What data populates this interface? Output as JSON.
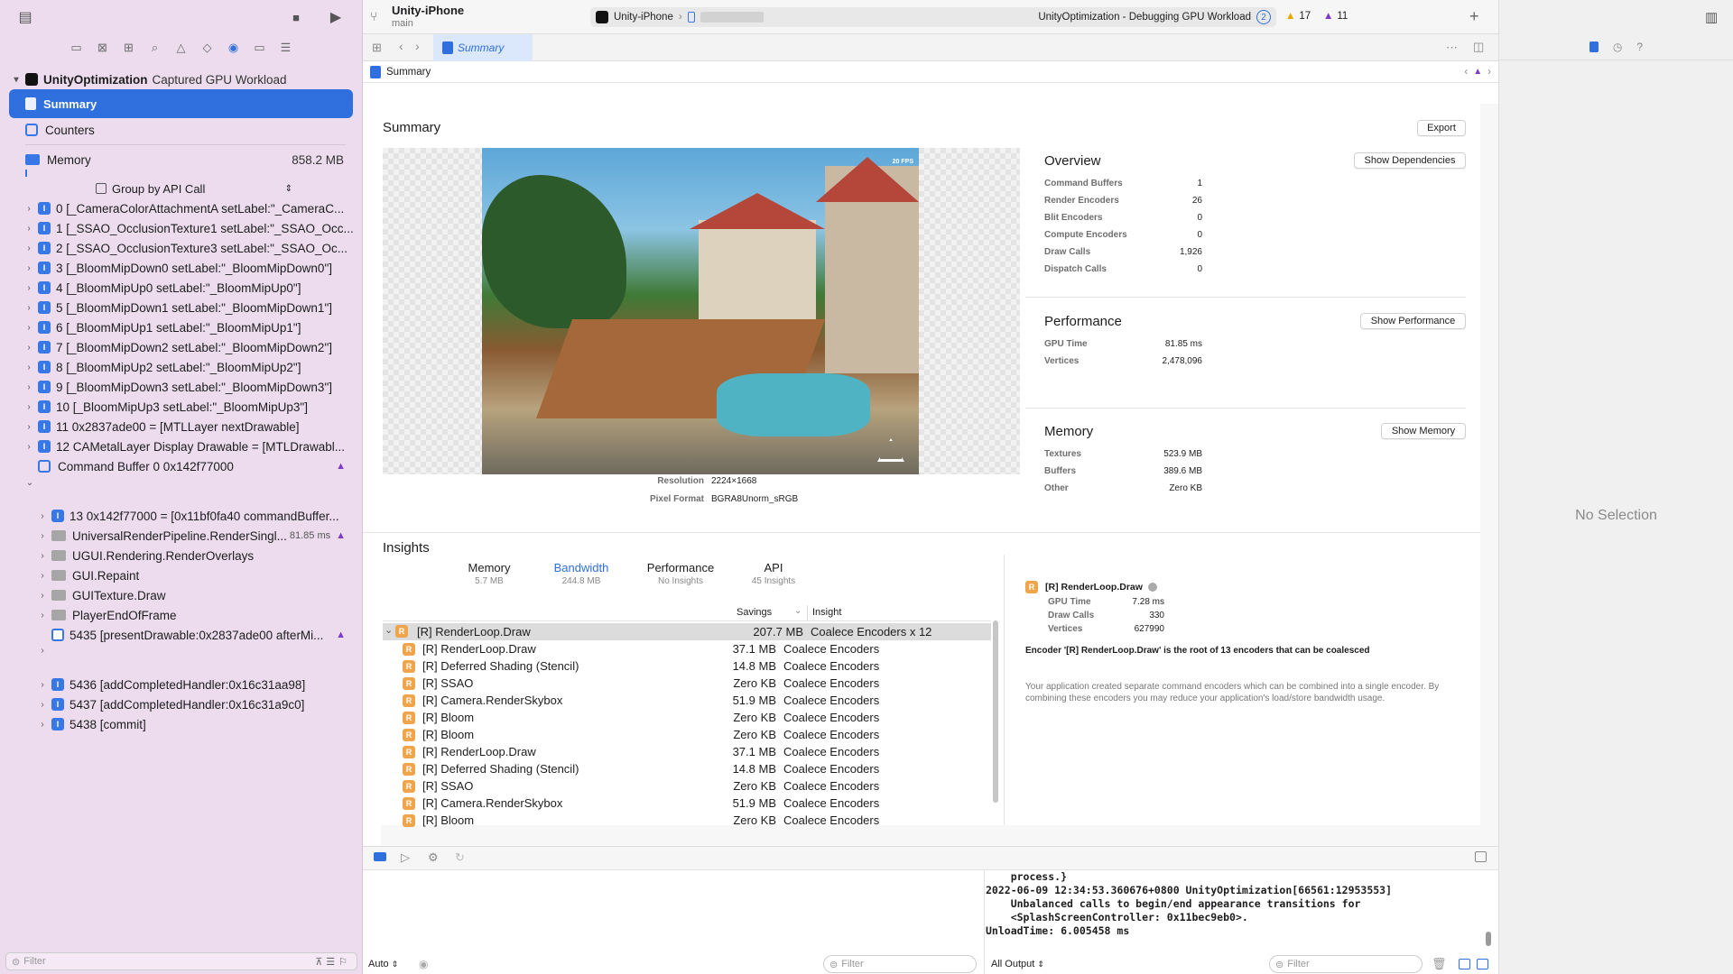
{
  "toolbar": {
    "scheme_name": "Unity-iPhone",
    "branch": "main",
    "target": "Unity-iPhone",
    "status": "UnityOptimization - Debugging GPU Workload",
    "status_badge": "2",
    "warnings": "17",
    "issues": "11"
  },
  "sidebar": {
    "root_title": "UnityOptimization",
    "root_subtitle": "Captured GPU Workload",
    "summary_label": "Summary",
    "counters_label": "Counters",
    "memory_label": "Memory",
    "memory_value": "858.2 MB",
    "group_by": "Group by API Call",
    "items": [
      "0 [_CameraColorAttachmentA setLabel:\"_CameraC...",
      "1 [_SSAO_OcclusionTexture1 setLabel:\"_SSAO_Occ...",
      "2 [_SSAO_OcclusionTexture3 setLabel:\"_SSAO_Oc...",
      "3 [_BloomMipDown0 setLabel:\"_BloomMipDown0\"]",
      "4 [_BloomMipUp0 setLabel:\"_BloomMipUp0\"]",
      "5 [_BloomMipDown1 setLabel:\"_BloomMipDown1\"]",
      "6 [_BloomMipUp1 setLabel:\"_BloomMipUp1\"]",
      "7 [_BloomMipDown2 setLabel:\"_BloomMipDown2\"]",
      "8 [_BloomMipUp2 setLabel:\"_BloomMipUp2\"]",
      "9 [_BloomMipDown3 setLabel:\"_BloomMipDown3\"]",
      "10 [_BloomMipUp3 setLabel:\"_BloomMipUp3\"]",
      "11 0x2837ade00 = [MTLLayer nextDrawable]",
      "12 CAMetalLayer Display Drawable = [MTLDrawabl..."
    ],
    "command_buffer": "Command Buffer 0 0x142f77000",
    "sub_items": [
      "13 0x142f77000 = [0x11bf0fa40 commandBuffer...",
      "UniversalRenderPipeline.RenderSingl...",
      "UGUI.Rendering.RenderOverlays",
      "GUI.Repaint",
      "GUITexture.Draw",
      "PlayerEndOfFrame",
      "5435 [presentDrawable:0x2837ade00 afterMi..."
    ],
    "sub_time": "81.85 ms",
    "tail_items": [
      "5436 [addCompletedHandler:0x16c31aa98]",
      "5437 [addCompletedHandler:0x16c31a9c0]",
      "5438 [commit]"
    ],
    "filter_placeholder": "Filter"
  },
  "editor": {
    "tab_label": "Summary",
    "jump_label": "Summary",
    "heading": "Summary",
    "export_label": "Export",
    "resolution_label": "Resolution",
    "resolution_value": "2224×1668",
    "pixel_format_label": "Pixel Format",
    "pixel_format_value": "BGRA8Unorm_sRGB",
    "fps_overlay": "20 FPS",
    "overview": {
      "title": "Overview",
      "button": "Show Dependencies",
      "rows": [
        {
          "label": "Command Buffers",
          "value": "1"
        },
        {
          "label": "Render Encoders",
          "value": "26"
        },
        {
          "label": "Blit Encoders",
          "value": "0"
        },
        {
          "label": "Compute Encoders",
          "value": "0"
        },
        {
          "label": "Draw Calls",
          "value": "1,926"
        },
        {
          "label": "Dispatch Calls",
          "value": "0"
        }
      ]
    },
    "performance": {
      "title": "Performance",
      "button": "Show Performance",
      "rows": [
        {
          "label": "GPU Time",
          "value": "81.85 ms"
        },
        {
          "label": "Vertices",
          "value": "2,478,096"
        }
      ]
    },
    "memory": {
      "title": "Memory",
      "button": "Show Memory",
      "rows": [
        {
          "label": "Textures",
          "value": "523.9 MB"
        },
        {
          "label": "Buffers",
          "value": "389.6 MB"
        },
        {
          "label": "Other",
          "value": "Zero KB"
        }
      ]
    }
  },
  "insights": {
    "title": "Insights",
    "tabs": [
      {
        "label": "Memory",
        "sub": "5.7 MB"
      },
      {
        "label": "Bandwidth",
        "sub": "244.8 MB"
      },
      {
        "label": "Performance",
        "sub": "No Insights"
      },
      {
        "label": "API",
        "sub": "45 Insights"
      }
    ],
    "col_savings": "Savings",
    "col_insight": "Insight",
    "parent": {
      "name": "[R] RenderLoop.Draw",
      "savings": "207.7 MB",
      "insight": "Coalece Encoders x 12"
    },
    "rows": [
      {
        "name": "[R] RenderLoop.Draw",
        "savings": "37.1 MB",
        "insight": "Coalece Encoders"
      },
      {
        "name": "[R] Deferred Shading (Stencil)",
        "savings": "14.8 MB",
        "insight": "Coalece Encoders"
      },
      {
        "name": "[R] SSAO",
        "savings": "Zero KB",
        "insight": "Coalece Encoders"
      },
      {
        "name": "[R] Camera.RenderSkybox",
        "savings": "51.9 MB",
        "insight": "Coalece Encoders"
      },
      {
        "name": "[R] Bloom",
        "savings": "Zero KB",
        "insight": "Coalece Encoders"
      },
      {
        "name": "[R] Bloom",
        "savings": "Zero KB",
        "insight": "Coalece Encoders"
      },
      {
        "name": "[R] RenderLoop.Draw",
        "savings": "37.1 MB",
        "insight": "Coalece Encoders"
      },
      {
        "name": "[R] Deferred Shading (Stencil)",
        "savings": "14.8 MB",
        "insight": "Coalece Encoders"
      },
      {
        "name": "[R] SSAO",
        "savings": "Zero KB",
        "insight": "Coalece Encoders"
      },
      {
        "name": "[R] Camera.RenderSkybox",
        "savings": "51.9 MB",
        "insight": "Coalece Encoders"
      },
      {
        "name": "[R] Bloom",
        "savings": "Zero KB",
        "insight": "Coalece Encoders"
      }
    ],
    "detail": {
      "title": "[R] RenderLoop.Draw",
      "rows": [
        {
          "label": "GPU Time",
          "value": "7.28 ms"
        },
        {
          "label": "Draw Calls",
          "value": "330"
        },
        {
          "label": "Vertices",
          "value": "627990"
        }
      ],
      "headline": "Encoder '[R] RenderLoop.Draw' is the root of 13 encoders that can be coalesced",
      "body": "Your application created separate command encoders which can be combined into a single encoder. By combining these encoders you may reduce your application's load/store bandwidth usage."
    }
  },
  "debug": {
    "auto_label": "Auto",
    "filter_placeholder": "Filter",
    "output_label": "All Output",
    "console_lines": [
      "    process.}",
      "2022-06-09 12:34:53.360676+0800 UnityOptimization[66561:12953553]",
      "    Unbalanced calls to begin/end appearance transitions for",
      "    <SplashScreenController: 0x11bec9eb0>.",
      "UnloadTime: 6.005458 ms"
    ]
  },
  "right_panel": {
    "no_selection": "No Selection"
  }
}
